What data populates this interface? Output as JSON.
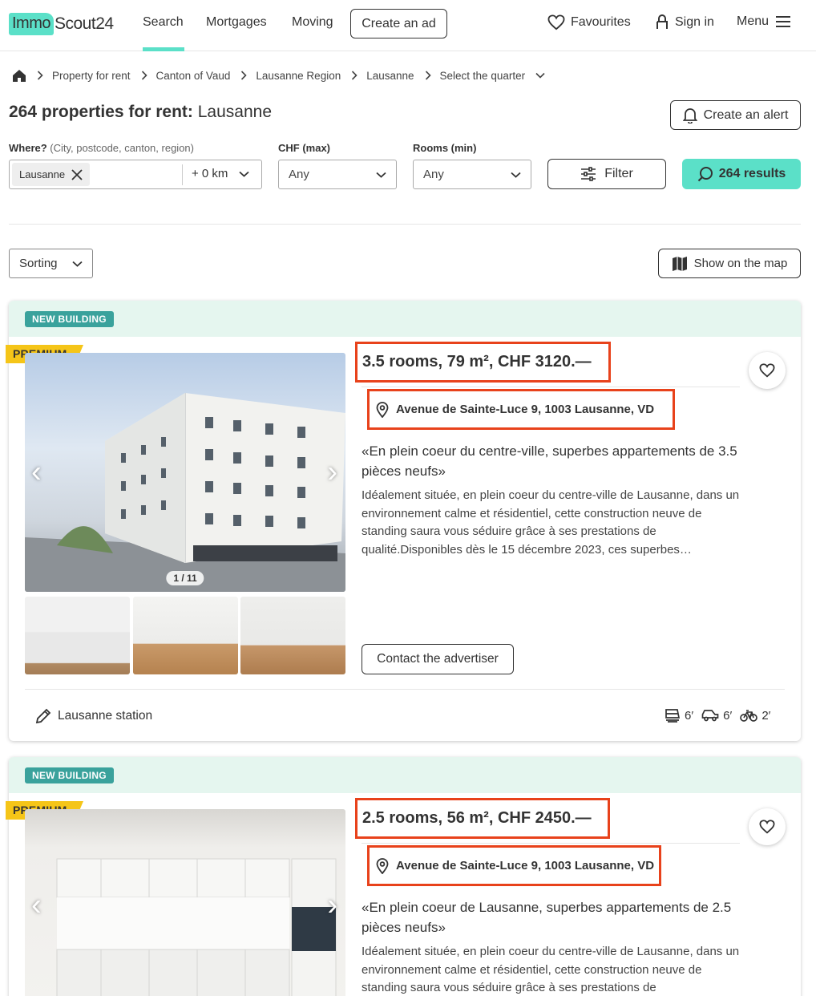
{
  "header": {
    "logo": {
      "immo": "Immo",
      "scout": "Scout24"
    },
    "nav": {
      "search": "Search",
      "mortgages": "Mortgages",
      "moving": "Moving"
    },
    "create_ad": "Create an ad",
    "favourites": "Favourites",
    "sign_in": "Sign in",
    "menu": "Menu"
  },
  "breadcrumb": [
    "Property for rent",
    "Canton of Vaud",
    "Lausanne Region",
    "Lausanne",
    "Select the quarter"
  ],
  "page_title": {
    "count": "264 properties for rent:",
    "location": "Lausanne"
  },
  "create_alert": "Create an alert",
  "filters": {
    "where_label": "Where?",
    "where_hint": "(City, postcode, canton, region)",
    "where_chip": "Lausanne",
    "radius": "+ 0 km",
    "chf_label": "CHF (max)",
    "chf_value": "Any",
    "rooms_label": "Rooms (min)",
    "rooms_value": "Any",
    "filter_button": "Filter",
    "results_button": "264 results"
  },
  "sorting": "Sorting",
  "show_map": "Show on the map",
  "listings": [
    {
      "badge": "NEW BUILDING",
      "premium": "PREMIUM",
      "title": "3.5 rooms, 79 m², CHF 3120.—",
      "address": "Avenue de Sainte-Luce 9, 1003 Lausanne, VD",
      "headline": "«En plein coeur du centre-ville, superbes appartements de 3.5 pièces neufs»",
      "description": "Idéalement située, en plein coeur du centre-ville de Lausanne, dans un environnement calme et résidentiel, cette construction neuve de standing saura vous séduire grâce à ses prestations de qualité.Disponibles dès le 15 décembre 2023, ces superbes…",
      "image_counter": "1 / 11",
      "contact": "Contact the advertiser",
      "station": "Lausanne station",
      "travel": {
        "train": "6′",
        "car": "6′",
        "bike": "2′"
      }
    },
    {
      "badge": "NEW BUILDING",
      "premium": "PREMIUM",
      "title": "2.5 rooms, 56 m², CHF 2450.—",
      "address": "Avenue de Sainte-Luce 9, 1003 Lausanne, VD",
      "headline": "«En plein coeur de Lausanne, superbes appartements de 2.5 pièces neufs»",
      "description": "Idéalement située, en plein coeur du centre-ville de Lausanne, dans un environnement calme et résidentiel, cette construction neuve de standing saura vous séduire grâce à ses prestations de"
    }
  ],
  "colors": {
    "brand": "#5be0c8",
    "highlight": "#e8421b",
    "premium": "#f5c518",
    "badge": "#3aa29c",
    "band": "#e5f6ef"
  }
}
